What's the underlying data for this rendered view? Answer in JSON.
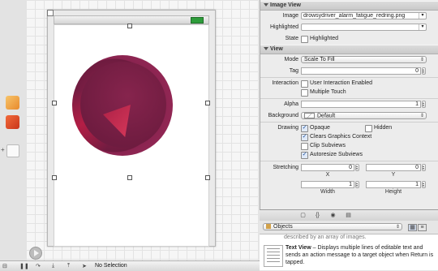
{
  "inspector": {
    "image_view": {
      "header": "Image View",
      "image_label": "Image",
      "image_value": "drowsydriver_alarm_fatigue_redring.png",
      "highlighted_label": "Highlighted",
      "highlighted_value": "",
      "state_label": "State",
      "state_highlighted_label": "Highlighted",
      "state_highlighted_checked": false
    },
    "view": {
      "header": "View",
      "mode_label": "Mode",
      "mode_value": "Scale To Fill",
      "tag_label": "Tag",
      "tag_value": "0",
      "interaction_label": "Interaction",
      "user_interaction_label": "User Interaction Enabled",
      "multiple_touch_label": "Multiple Touch",
      "alpha_label": "Alpha",
      "alpha_value": "1",
      "background_label": "Background",
      "background_value": "Default",
      "drawing_label": "Drawing",
      "opaque_label": "Opaque",
      "hidden_label": "Hidden",
      "clears_graphics_label": "Clears Graphics Context",
      "clip_subviews_label": "Clip Subviews",
      "autoresize_label": "Autoresize Subviews",
      "stretching_label": "Stretching",
      "stretch_x_value": "0",
      "stretch_y_value": "0",
      "x_label": "X",
      "y_label": "Y",
      "stretch_w_value": "1",
      "stretch_h_value": "1",
      "width_label": "Width",
      "height_label": "Height"
    }
  },
  "library": {
    "selector_value": "Objects",
    "partial_text": "described by an array of images.",
    "text_view_title": "Text View",
    "text_view_desc": " – Displays multiple lines of editable text and sends an action message to a target object when Return is tapped."
  },
  "bottom_bar": {
    "status": "No Selection"
  },
  "colors": {
    "ring_outer": "#9f2b5a",
    "ring_inner": "#6f1c40",
    "accent_wedge": "#e03a5c",
    "battery": "#2d9c3a"
  }
}
